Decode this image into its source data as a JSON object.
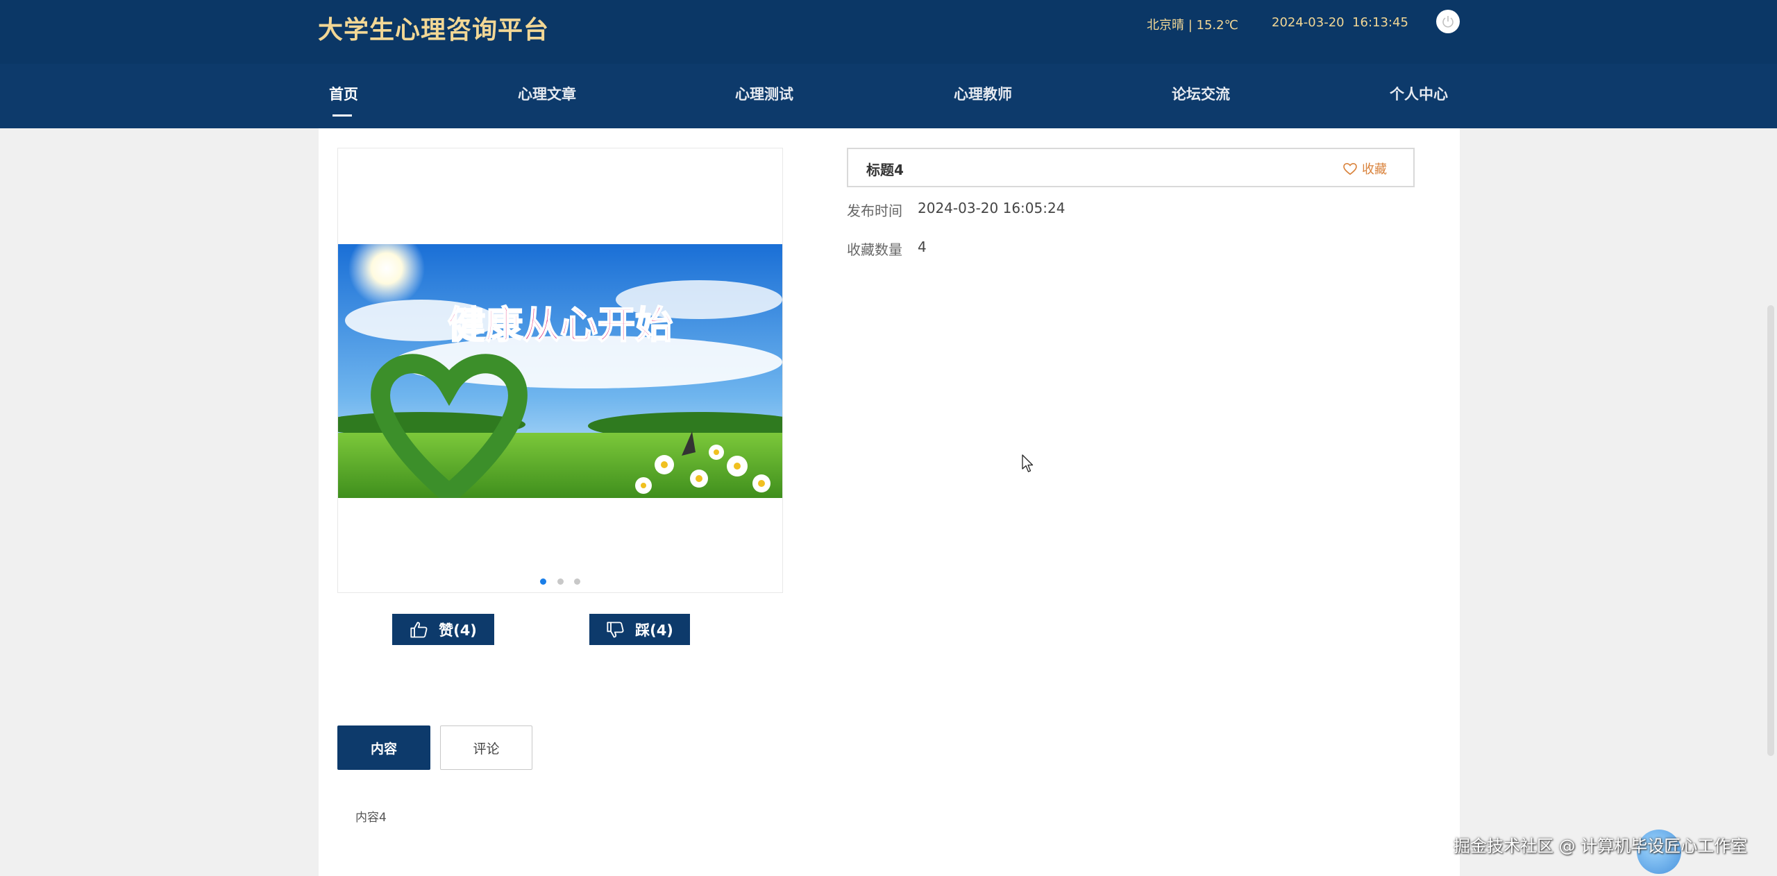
{
  "header": {
    "site_title": "大学生心理咨询平台",
    "weather": "北京晴 | 15.2℃",
    "datetime": "2024-03-20  16:13:45"
  },
  "nav": {
    "items": [
      {
        "label": "首页",
        "active": true
      },
      {
        "label": "心理文章"
      },
      {
        "label": "心理测试"
      },
      {
        "label": "心理教师"
      },
      {
        "label": "论坛交流"
      },
      {
        "label": "个人中心"
      }
    ]
  },
  "detail": {
    "title": "标题4",
    "favorite_label": "收藏",
    "publish_label": "发布时间",
    "publish_value": "2024-03-20 16:05:24",
    "fav_count_label": "收藏数量",
    "fav_count_value": "4"
  },
  "banner": {
    "text": "健康从心开始",
    "slides": 3,
    "active_slide": 0
  },
  "votes": {
    "like_label": "赞(4)",
    "dislike_label": "踩(4)"
  },
  "tabs": {
    "content_label": "内容",
    "comment_label": "评论"
  },
  "content": {
    "text": "内容4"
  },
  "watermark": {
    "text": "掘金技术社区 @ 计算机毕设匠心工作室"
  },
  "colors": {
    "header_bg": "#0b3766",
    "nav_bg": "#0d3a6b",
    "title_gold": "#f2d795",
    "favorite_orange": "#d9823b",
    "dot_active": "#1a7ee8"
  },
  "icons": {
    "power": "power-icon",
    "favorite": "heart-icon",
    "like": "thumbs-up-icon",
    "dislike": "thumbs-down-icon",
    "cursor": "mouse-cursor-icon"
  }
}
